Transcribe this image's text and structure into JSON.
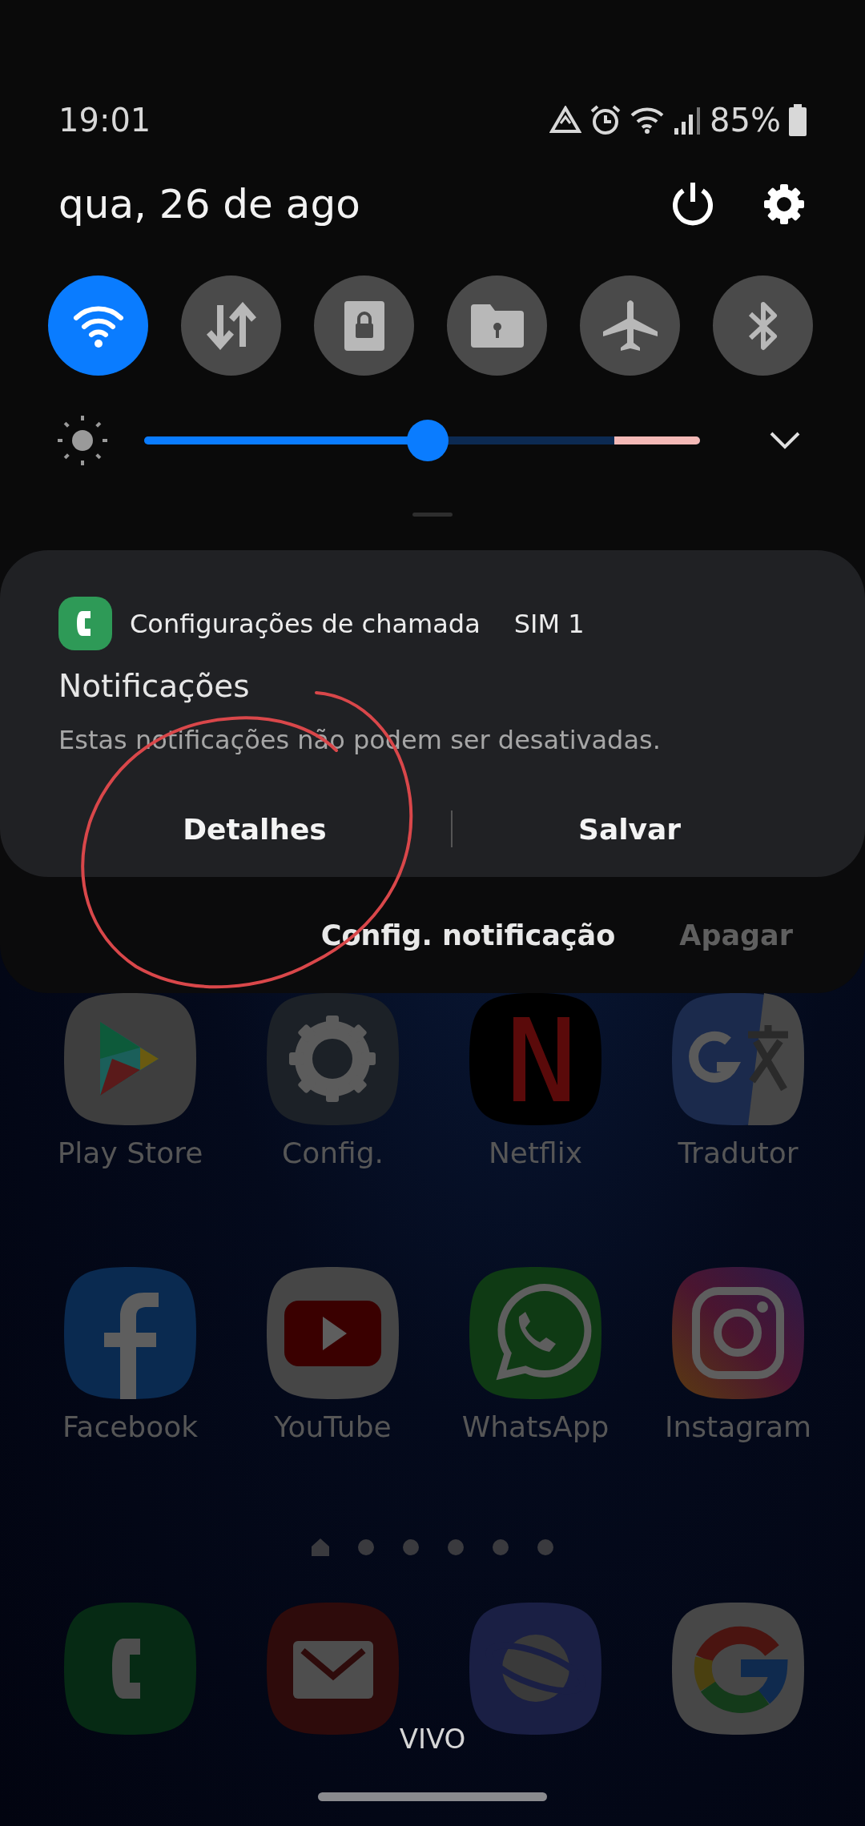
{
  "status_bar": {
    "time": "19:01",
    "battery": "85%"
  },
  "quick_panel": {
    "date": "qua, 26 de ago",
    "toggles": [
      {
        "on": true
      },
      {
        "on": false
      },
      {
        "on": false
      },
      {
        "on": false
      },
      {
        "on": false
      },
      {
        "on": false
      }
    ],
    "brightness": {
      "level": 0.51
    }
  },
  "notification": {
    "app_name": "Configurações de chamada",
    "sim": "SIM 1",
    "title": "Notificações",
    "text": "Estas notificações não podem ser desativadas.",
    "actions": [
      "Detalhes",
      "Salvar"
    ]
  },
  "panel_actions": [
    {
      "label": "Config. notificação",
      "disabled": false
    },
    {
      "label": "Apagar",
      "disabled": true
    }
  ],
  "home": {
    "apps": [
      "Play Store",
      "Config.",
      "Netflix",
      "Tradutor",
      "Facebook",
      "YouTube",
      "WhatsApp",
      "Instagram"
    ],
    "page_indicator": [
      {
        "kind": "home"
      },
      {
        "kind": "dot"
      },
      {
        "kind": "dot"
      },
      {
        "kind": "dot"
      },
      {
        "kind": "dot"
      },
      {
        "kind": "dot"
      }
    ],
    "carrier": "VIVO"
  }
}
